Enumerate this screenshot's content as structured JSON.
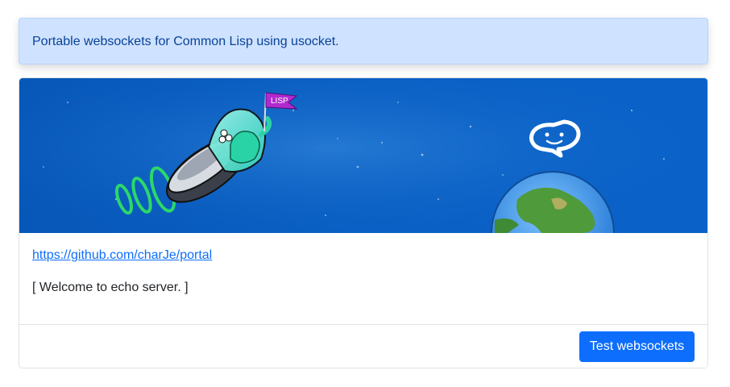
{
  "alert": {
    "text": "Portable websockets for Common Lisp using usocket."
  },
  "banner": {
    "flag_text": "LISP"
  },
  "card": {
    "link_text": "https://github.com/charJe/portal",
    "status_text": "[ Welcome to echo server. ]"
  },
  "footer": {
    "button_label": "Test websockets"
  },
  "colors": {
    "primary": "#0d6efd",
    "alert_bg": "#cfe2ff",
    "alert_text": "#084298"
  }
}
